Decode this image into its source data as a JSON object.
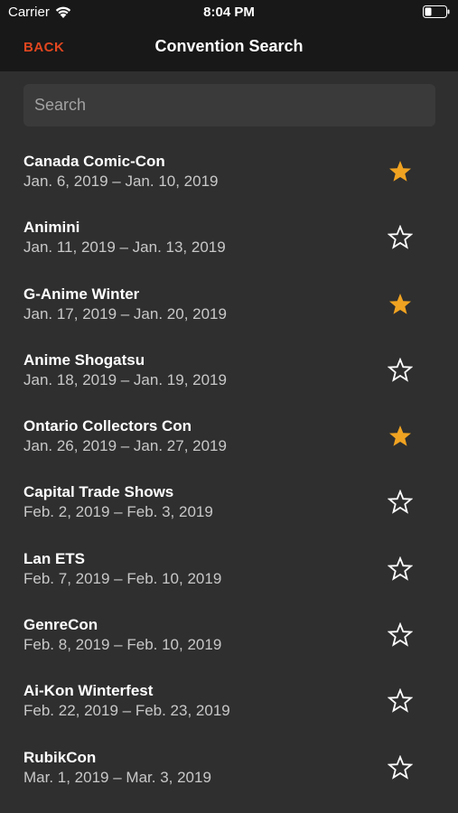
{
  "status_bar": {
    "carrier": "Carrier",
    "time": "8:04 PM"
  },
  "nav": {
    "back_label": "BACK",
    "title": "Convention Search"
  },
  "search": {
    "placeholder": "Search",
    "value": ""
  },
  "colors": {
    "accent": "#e0461f",
    "star_filled": "#f0a321",
    "background": "#2f2f2f",
    "topbar": "#181818"
  },
  "conventions": [
    {
      "name": "Canada Comic-Con",
      "dates": "Jan. 6, 2019 – Jan. 10, 2019",
      "favorite": true
    },
    {
      "name": "Animini",
      "dates": "Jan. 11, 2019 – Jan. 13, 2019",
      "favorite": false
    },
    {
      "name": "G-Anime Winter",
      "dates": "Jan. 17, 2019 – Jan. 20, 2019",
      "favorite": true
    },
    {
      "name": "Anime Shogatsu",
      "dates": "Jan. 18, 2019 – Jan. 19, 2019",
      "favorite": false
    },
    {
      "name": "Ontario Collectors Con",
      "dates": "Jan. 26, 2019 – Jan. 27, 2019",
      "favorite": true
    },
    {
      "name": "Capital Trade Shows",
      "dates": "Feb. 2, 2019 – Feb. 3, 2019",
      "favorite": false
    },
    {
      "name": "Lan ETS",
      "dates": "Feb. 7, 2019 – Feb. 10, 2019",
      "favorite": false
    },
    {
      "name": "GenreCon",
      "dates": "Feb. 8, 2019 – Feb. 10, 2019",
      "favorite": false
    },
    {
      "name": "Ai-Kon Winterfest",
      "dates": "Feb. 22, 2019 – Feb. 23, 2019",
      "favorite": false
    },
    {
      "name": "RubikCon",
      "dates": "Mar. 1, 2019 – Mar. 3, 2019",
      "favorite": false
    }
  ]
}
